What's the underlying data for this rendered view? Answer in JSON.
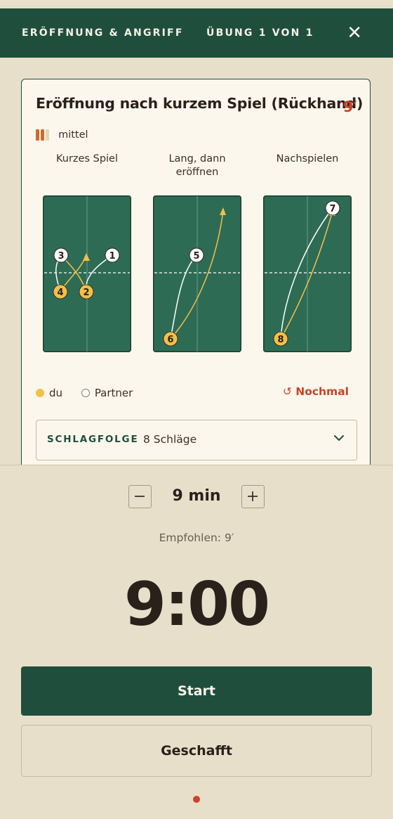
{
  "header": {
    "section": "ERÖFFNUNG & ANGRIFF",
    "progress": "ÜBUNG 1 VON 1",
    "close_icon": "close-icon"
  },
  "drill": {
    "title": "Eröffnung nach kurzem Spiel (Rückhand)",
    "duration": "9′",
    "level": {
      "label": "mittel",
      "filled": 2,
      "total": 3
    },
    "diagrams": [
      {
        "label": "Kurzes Spiel"
      },
      {
        "label": "Lang, dann eröffnen"
      },
      {
        "label": "Nachspielen"
      }
    ],
    "legend": {
      "you": "du",
      "partner": "Partner"
    },
    "replay": "Nochmal",
    "sequence": {
      "label": "SCHLAGFOLGE",
      "count": "8 Schläge"
    }
  },
  "timer": {
    "minutes": "9 min",
    "recommended": "Empfohlen: 9′",
    "display": "9:00",
    "decrease_icon": "minus-icon",
    "increase_icon": "plus-icon"
  },
  "actions": {
    "start": "Start",
    "done": "Geschafft"
  },
  "colors": {
    "brand": "#1f4e3d",
    "accent": "#c8442a",
    "you": "#f2c04a",
    "partner": "#ffffff",
    "table": "#2e6b55",
    "background": "#e8dfca"
  }
}
